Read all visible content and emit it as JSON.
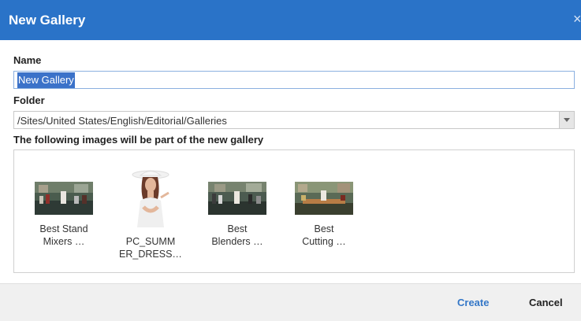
{
  "dialog": {
    "title": "New Gallery",
    "close_glyph": "×",
    "name_label": "Name",
    "name_value": "New Gallery",
    "folder_label": "Folder",
    "folder_value": "/Sites/United States/English/Editorial/Galleries",
    "images_label": "The following images will be part of the new gallery",
    "images": [
      {
        "caption_line1": "Best Stand",
        "caption_line2": "Mixers …",
        "icon": "kitchen-display-photo"
      },
      {
        "caption_line1": "PC_SUMM",
        "caption_line2": "ER_DRESS…",
        "icon": "woman-in-white-hat-photo"
      },
      {
        "caption_line1": "Best",
        "caption_line2": "Blenders …",
        "icon": "kitchen-display-photo"
      },
      {
        "caption_line1": "Best",
        "caption_line2": "Cutting …",
        "icon": "kitchen-counter-photo"
      }
    ],
    "create_label": "Create",
    "cancel_label": "Cancel"
  },
  "colors": {
    "header": "#2a73c8",
    "accent": "#3477c7",
    "footer": "#f0f0f0"
  }
}
